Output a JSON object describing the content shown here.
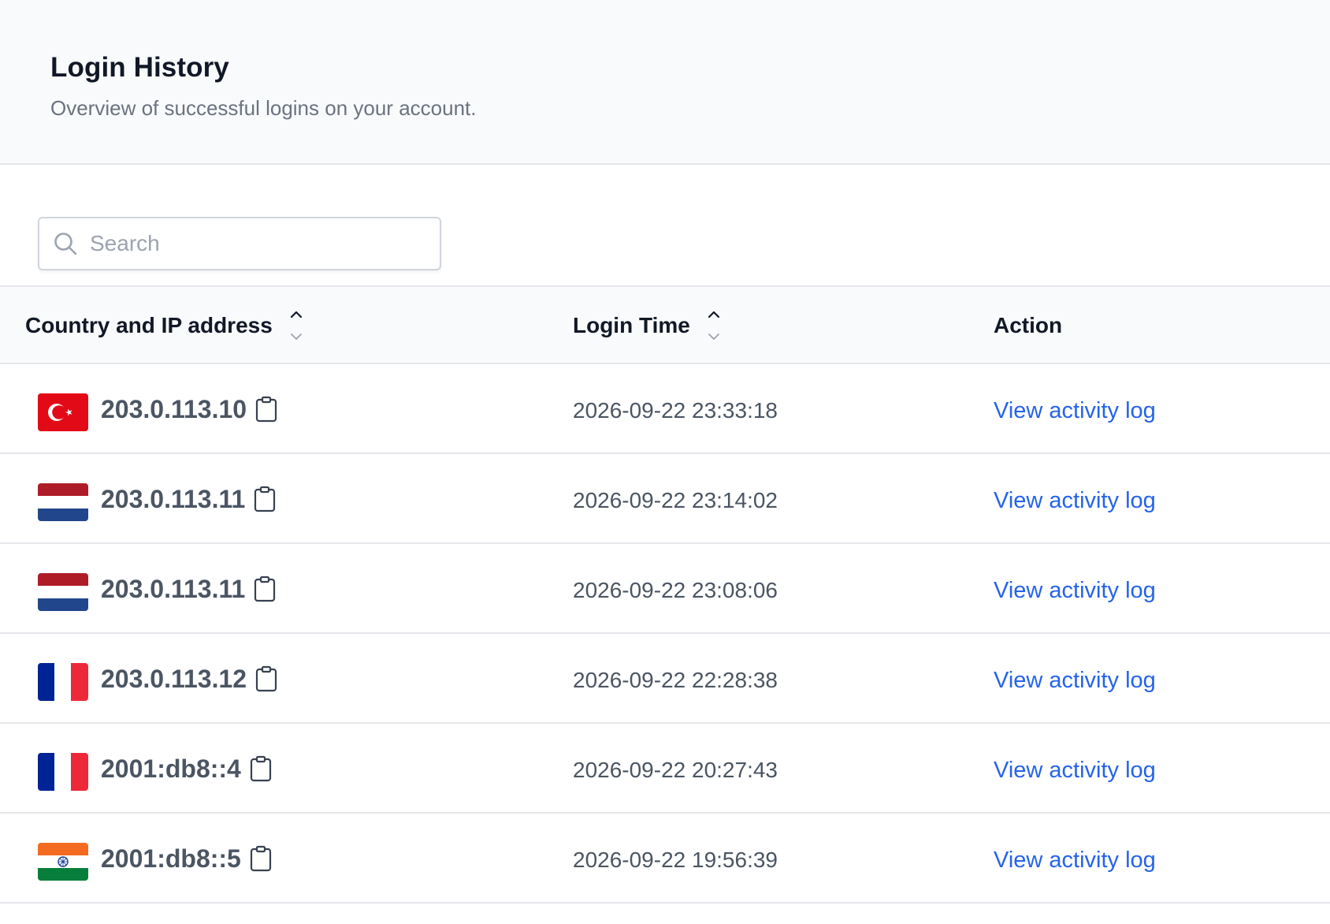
{
  "header": {
    "title": "Login History",
    "subtitle": "Overview of successful logins on your account."
  },
  "search": {
    "placeholder": "Search",
    "value": "",
    "icon": "search-icon"
  },
  "table": {
    "columns": [
      {
        "label": "Country and IP address",
        "sortable": true
      },
      {
        "label": "Login Time",
        "sortable": true
      },
      {
        "label": "Action",
        "sortable": false
      }
    ],
    "rows": [
      {
        "flag": "turkey",
        "ip": "203.0.113.10",
        "time": "2026-09-22 23:33:18",
        "action": "View activity log"
      },
      {
        "flag": "netherlands",
        "ip": "203.0.113.11",
        "time": "2026-09-22 23:14:02",
        "action": "View activity log"
      },
      {
        "flag": "netherlands",
        "ip": "203.0.113.11",
        "time": "2026-09-22 23:08:06",
        "action": "View activity log"
      },
      {
        "flag": "france",
        "ip": "203.0.113.12",
        "time": "2026-09-22 22:28:38",
        "action": "View activity log"
      },
      {
        "flag": "france",
        "ip": "2001:db8::4",
        "time": "2026-09-22 20:27:43",
        "action": "View activity log"
      },
      {
        "flag": "india",
        "ip": "2001:db8::5",
        "time": "2026-09-22 19:56:39",
        "action": "View activity log"
      }
    ]
  },
  "colors": {
    "link": "#2563eb",
    "header_bg": "#f9fafb",
    "border": "#e5e7eb"
  }
}
